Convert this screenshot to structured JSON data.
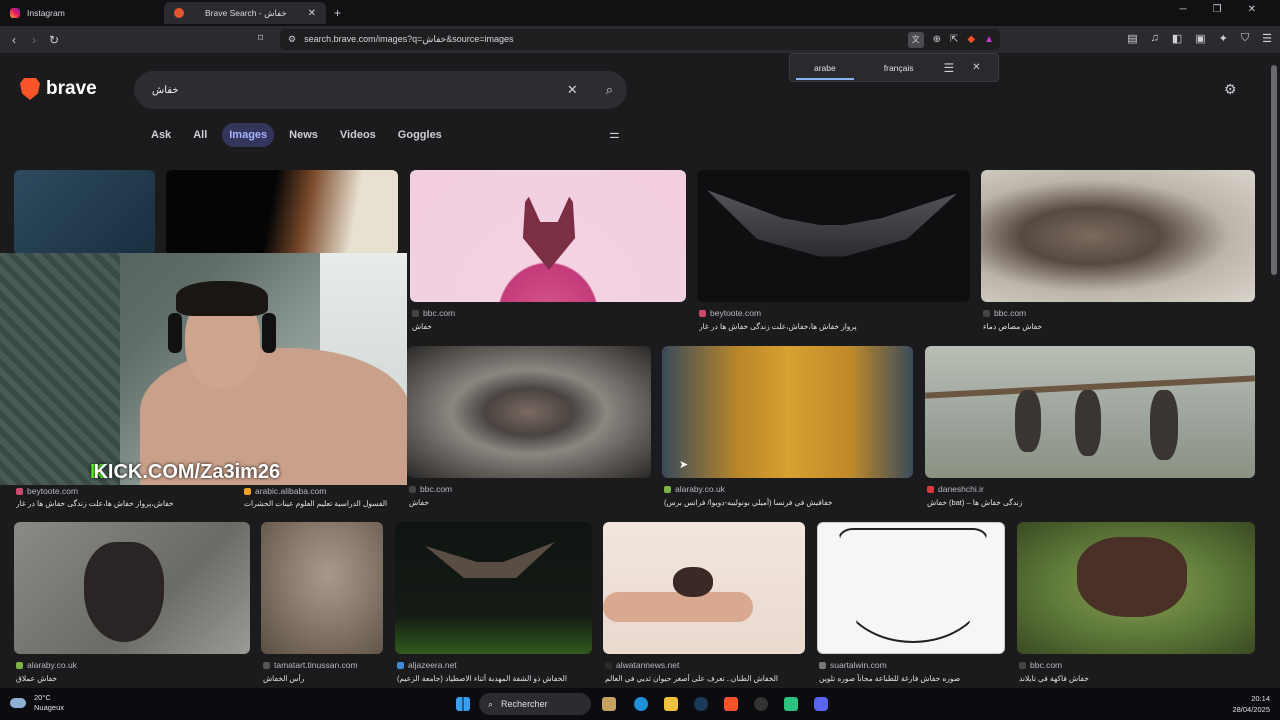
{
  "browser": {
    "tabs": [
      {
        "title": "Instagram",
        "icon": "instagram-icon"
      },
      {
        "title": "Brave Search - خفاش",
        "icon": "brave-icon"
      }
    ],
    "new_tab": "+",
    "url": "search.brave.com/images?q=خفاش&source=images"
  },
  "translate": {
    "source": "arabe",
    "target": "français"
  },
  "search": {
    "logo": "brave",
    "query": "خفاش",
    "tabs": [
      "Ask",
      "All",
      "Images",
      "News",
      "Videos",
      "Goggles"
    ],
    "active_tab": "Images"
  },
  "results": [
    {
      "source": "bbc.com",
      "caption": "خفاش",
      "color": "#f2cde0"
    },
    {
      "source": "beytoote.com",
      "caption": "پرواز خفاش ها،خفاش،علت زندگی خفاش ها در غار",
      "color": "#101014"
    },
    {
      "source": "bbc.com",
      "caption": "خفاش مصاص دماء",
      "color": "#8e8278"
    },
    {
      "source": "beytoote.com",
      "caption": "خفاش،پرواز خفاش ها،علت زندگی خفاش ها در غار",
      "color": "#3d5a6a"
    },
    {
      "source": "arabic.alibaba.com",
      "caption": "الفسول الدراسية تعليم العلوم عينات الحشرات",
      "color": "#1a1410"
    },
    {
      "source": "bbc.com",
      "caption": "خفاش",
      "color": "#7d756f"
    },
    {
      "source": "alaraby.co.uk",
      "caption": "خفافيش في فرنسا (أميلي بونوليبه-دوبوا/ فرانس برس)",
      "color": "#c08a2a"
    },
    {
      "source": "daneshchi.ir",
      "caption": "خفاش (bat) – زندگی خفاش ها",
      "color": "#9aa29a"
    },
    {
      "source": "alaraby.co.uk",
      "caption": "خفاش عملاق",
      "color": "#7a7a78"
    },
    {
      "source": "tamatart.tinussan.com",
      "caption": "رأس الخفاش",
      "color": "#8c7d6e"
    },
    {
      "source": "aljazeera.net",
      "caption": "الخفاش ذو الشفة المهدبة أثناء الاصطياد (جامعة الزعيم)",
      "color": "#0e1410"
    },
    {
      "source": "alwatannews.net",
      "caption": "الخفاش الطنان.. تعرف على أصغر حيوان ثديي في العالم",
      "color": "#e9d9cf"
    },
    {
      "source": "suartalwin.com",
      "caption": "صوره خفاش فارغة للطباعة مجاناً صوره تلوين",
      "color": "#f4f4f4"
    },
    {
      "source": "bbc.com",
      "caption": "خفاش فاكهة في تايلاند",
      "color": "#5f7a3a"
    }
  ],
  "overlay": {
    "kick_prefix": "K",
    "kick_text": "KICK.COM/Za3im26"
  },
  "taskbar": {
    "weather_temp": "20°C",
    "weather_desc": "Nuageux",
    "search_label": "Rechercher",
    "time": "20:14",
    "date": "28/04/2025"
  }
}
